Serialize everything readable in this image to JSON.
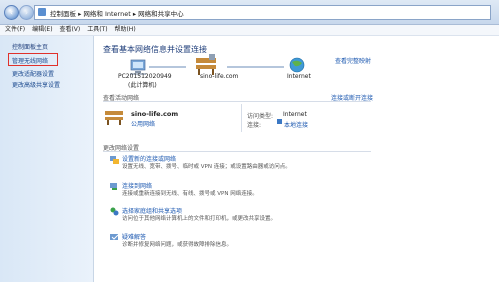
{
  "address": {
    "segments": "控制面板 ▸ 网络和 Internet ▸ 网络和共享中心"
  },
  "menu": [
    "文件(F)",
    "编辑(E)",
    "查看(V)",
    "工具(T)",
    "帮助(H)"
  ],
  "sidebar": {
    "items": [
      "控制面板主页",
      "管理无线网络",
      "更改适配器设置",
      "更改高级共享设置"
    ]
  },
  "main": {
    "title": "查看基本网络信息并设置连接",
    "view_full_map": "查看完整映射",
    "map": {
      "computer_name": "PC201512020949",
      "computer_sub": "(此计算机)",
      "network": "sino-life.com",
      "internet": "Internet"
    },
    "active_section": "查看活动网络",
    "connect_disconnect": "连接或断开连接",
    "active": {
      "name": "sino-life.com",
      "type": "公用网络",
      "access_label": "访问类型:",
      "access_value": "Internet",
      "conn_label": "连接:",
      "conn_value": "本地连接"
    },
    "change_section": "更改网络设置",
    "tasks": [
      {
        "title": "设置新的连接或网络",
        "desc": "设置无线、宽带、拨号、临时或 VPN 连接；或设置路由器或访问点。"
      },
      {
        "title": "连接到网络",
        "desc": "连接或重新连接到无线、有线、拨号或 VPN 网络连接。"
      },
      {
        "title": "选择家庭组和共享选项",
        "desc": "访问位于其他网络计算机上的文件和打印机，或更改共享设置。"
      },
      {
        "title": "疑难解答",
        "desc": "诊断并修复网络问题，或获得故障排除信息。"
      }
    ]
  },
  "colors": {
    "link": "#1c58b0",
    "highlight": "#e0312b"
  }
}
